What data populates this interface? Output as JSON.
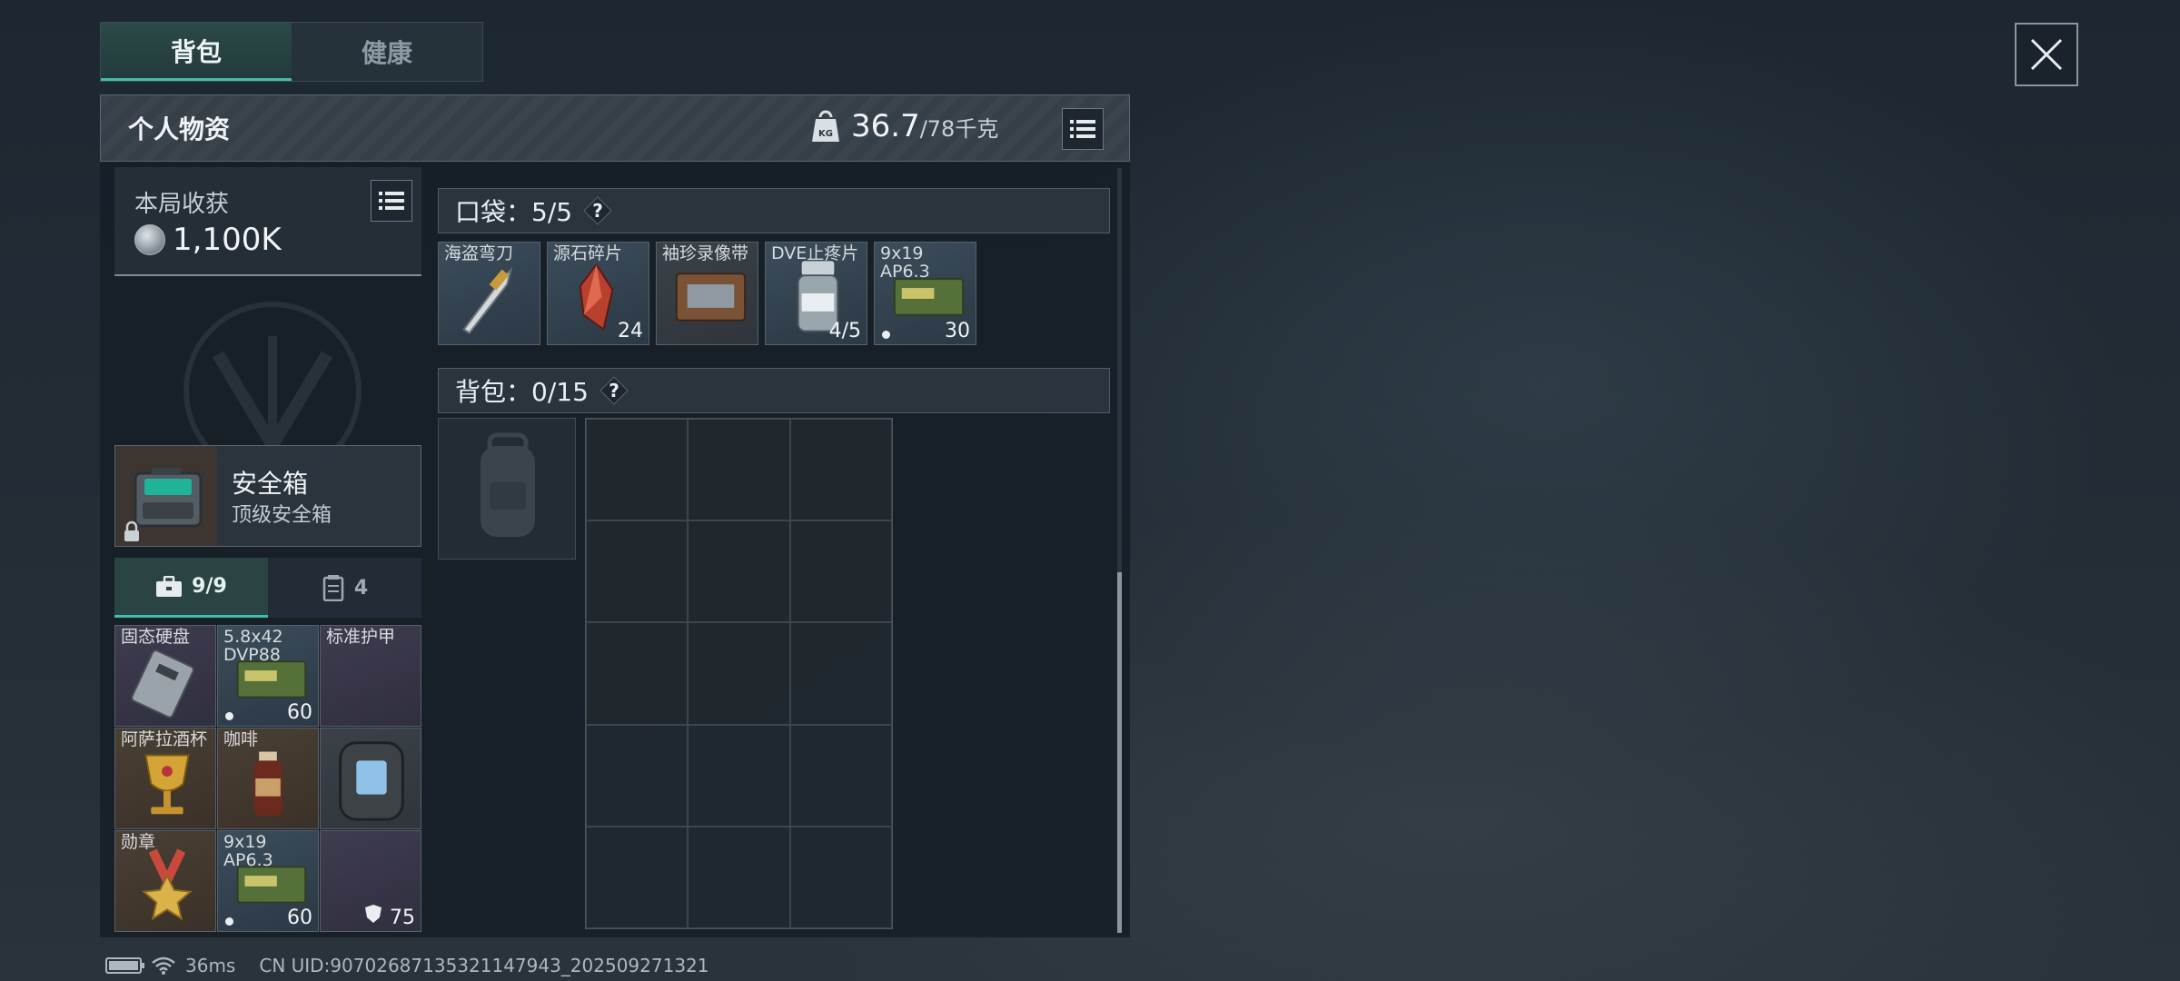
{
  "top_tabs": [
    {
      "label": "背包",
      "active": true
    },
    {
      "label": "健康",
      "active": false
    }
  ],
  "panel": {
    "title": "个人物资",
    "weight_current": "36.7",
    "weight_max": "/78千克"
  },
  "earnings": {
    "label": "本局收获",
    "value": "1,100K"
  },
  "safe_box": {
    "name": "安全箱",
    "subtitle": "顶级安全箱"
  },
  "safe_tabs": [
    {
      "label": "9/9",
      "icon": "briefcase-icon",
      "active": true
    },
    {
      "label": "4",
      "icon": "vest-icon",
      "active": false
    }
  ],
  "safe_items": [
    {
      "name": "固态硬盘",
      "count": "",
      "dot": false,
      "rarity": "purple",
      "icon": "ssd-icon"
    },
    {
      "name": "5.8x42\nDVP88",
      "count": "60",
      "dot": true,
      "rarity": "blue",
      "icon": "ammo-box-icon"
    },
    {
      "name": "标准护甲",
      "count": "",
      "dot": false,
      "rarity": "purple",
      "icon": "armor-icon"
    },
    {
      "name": "阿萨拉酒杯",
      "count": "",
      "dot": false,
      "rarity": "gold",
      "icon": "goblet-icon"
    },
    {
      "name": "咖啡",
      "count": "",
      "dot": false,
      "rarity": "gold",
      "icon": "coffee-bottle-icon"
    },
    {
      "name": "",
      "count": "",
      "dot": false,
      "rarity": "gray",
      "icon": "armor-vest-icon"
    },
    {
      "name": "勋章",
      "count": "",
      "dot": false,
      "rarity": "gold",
      "icon": "medal-icon"
    },
    {
      "name": "9x19\nAP6.3",
      "count": "60",
      "dot": true,
      "rarity": "blue",
      "icon": "ammo-box-icon"
    },
    {
      "name": "",
      "count": "75",
      "dot": false,
      "rarity": "purple",
      "icon": "shield-icon"
    }
  ],
  "pocket": {
    "title": "口袋：5/5",
    "items": [
      {
        "name": "海盗弯刀",
        "count": "",
        "dot": false,
        "rarity": "blue",
        "icon": "knife-icon"
      },
      {
        "name": "源石碎片",
        "count": "24",
        "dot": false,
        "rarity": "blue",
        "icon": "crystal-icon"
      },
      {
        "name": "袖珍录像带",
        "count": "",
        "dot": false,
        "rarity": "gray",
        "icon": "tape-icon"
      },
      {
        "name": "DVE止疼片",
        "count": "4/5",
        "dot": false,
        "rarity": "blue",
        "icon": "pill-bottle-icon"
      },
      {
        "name": "9x19\nAP6.3",
        "count": "30",
        "dot": true,
        "rarity": "blue",
        "icon": "ammo-box-icon"
      }
    ]
  },
  "backpack": {
    "title": "背包：0/15"
  },
  "status_bar": {
    "ping": "36ms",
    "uid": "CN UID:907026871353211479​43_202509271321"
  }
}
